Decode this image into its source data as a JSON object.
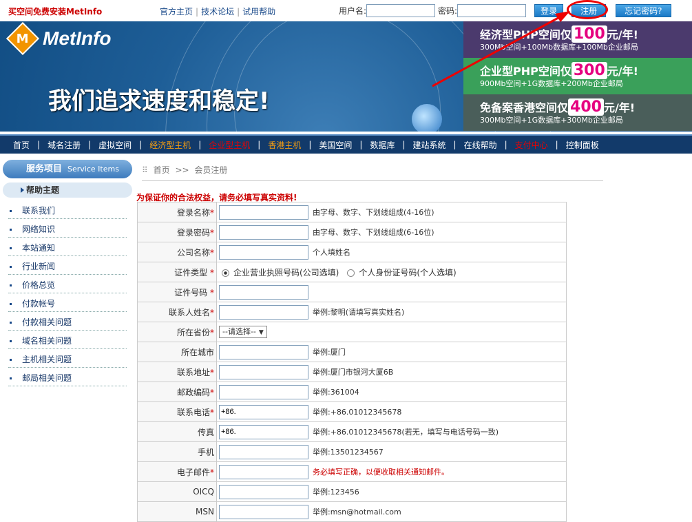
{
  "top": {
    "promo": "买空间免费安装MetInfo",
    "links": [
      "官方主页",
      "技术论坛",
      "试用帮助"
    ],
    "user_label": "用户名:",
    "pass_label": "密码:",
    "login_btn": "登录",
    "register_btn": "注册",
    "forgot_btn": "忘记密码?"
  },
  "banner": {
    "logo_letter": "M",
    "brand": "MetInfo",
    "slogan": "我们追求速度和稳定!",
    "ads": [
      {
        "title_pre": "经济型PHP空间仅",
        "price": "100",
        "title_post": "元/年!",
        "detail": "300Mb空间+100Mb数据库+100Mb企业邮局"
      },
      {
        "title_pre": "企业型PHP空间仅",
        "price": "300",
        "title_post": "元/年!",
        "detail": "900Mb空间+1G数据库+200Mb企业邮局"
      },
      {
        "title_pre": "免备案香港空间仅",
        "price": "400",
        "title_post": "元/年!",
        "detail": "300Mb空间+1G数据库+300Mb企业邮局"
      }
    ]
  },
  "nav": [
    {
      "label": "首页",
      "color": "white"
    },
    {
      "label": "域名注册",
      "color": "white"
    },
    {
      "label": "虚拟空间",
      "color": "white"
    },
    {
      "label": "经济型主机",
      "color": "orange"
    },
    {
      "label": "企业型主机",
      "color": "red"
    },
    {
      "label": "香港主机",
      "color": "orange"
    },
    {
      "label": "美国空间",
      "color": "white"
    },
    {
      "label": "数据库",
      "color": "white"
    },
    {
      "label": "建站系统",
      "color": "white"
    },
    {
      "label": "在线帮助",
      "color": "white"
    },
    {
      "label": "支付中心",
      "color": "red"
    },
    {
      "label": "控制面板",
      "color": "white"
    }
  ],
  "sidebar": {
    "title": "服务项目",
    "title_en": "Service Items",
    "sub": "帮助主题",
    "items": [
      "联系我们",
      "网络知识",
      "本站通知",
      "行业新闻",
      "价格总览",
      "付款帐号",
      "付款相关问题",
      "域名相关问题",
      "主机相关问题",
      "邮局相关问题"
    ]
  },
  "crumb": {
    "home": "首页",
    "sep": ">>",
    "current": "会员注册"
  },
  "warning": "为保证你的合法权益，请务必填写真实资料!",
  "form": {
    "login_name": {
      "label": "登录名称",
      "hint": "由字母、数字、下划线组成(4-16位)"
    },
    "login_pass": {
      "label": "登录密码",
      "hint": "由字母、数字、下划线组成(6-16位)"
    },
    "company": {
      "label": "公司名称",
      "hint": "个人填姓名"
    },
    "id_type": {
      "label": "证件类型",
      "opt1": "企业营业执照号码(公司选填)",
      "opt2": "个人身份证号码(个人选填)"
    },
    "id_number": {
      "label": "证件号码"
    },
    "contact": {
      "label": "联系人姓名",
      "hint": "举例:黎明(请填写真实姓名)"
    },
    "province": {
      "label": "所在省份",
      "value": "--请选择--"
    },
    "city": {
      "label": "所在城市",
      "hint": "举例:厦门"
    },
    "address": {
      "label": "联系地址",
      "hint": "举例:厦门市银河大厦6B"
    },
    "zip": {
      "label": "邮政编码",
      "hint": "举例:361004"
    },
    "phone": {
      "label": "联系电话",
      "value": "+86.",
      "hint": "举例:+86.01012345678"
    },
    "fax": {
      "label": "传真",
      "value": "+86.",
      "hint": "举例:+86.01012345678(若无，填写与电话号码一致)"
    },
    "mobile": {
      "label": "手机",
      "hint": "举例:13501234567"
    },
    "email": {
      "label": "电子邮件",
      "hint": "务必填写正确，以便收取相关通知邮件。"
    },
    "oicq": {
      "label": "OICQ",
      "hint": "举例:123456"
    },
    "msn": {
      "label": "MSN",
      "hint": "举例:msn@hotmail.com"
    }
  },
  "colors": {
    "nav_bg": "#123a6a",
    "warning": "#cc0000",
    "annotation": "#ee0000"
  }
}
